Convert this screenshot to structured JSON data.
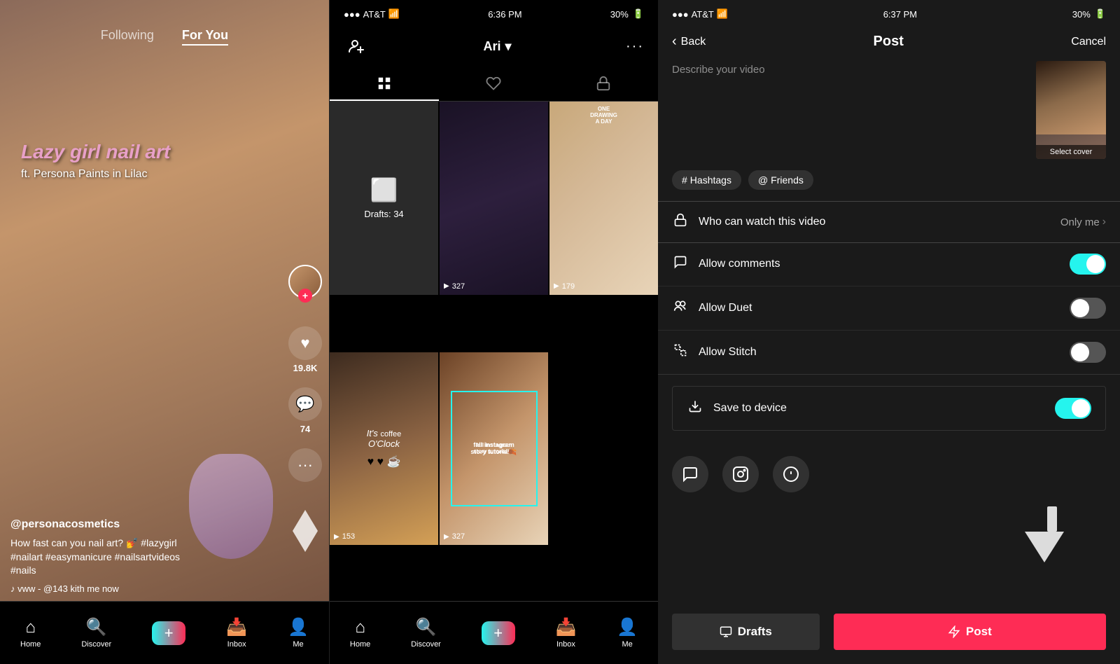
{
  "panel1": {
    "status": {
      "time": "6:36 PM",
      "carrier": "AT&T",
      "battery": "30%",
      "signal": "●●●"
    },
    "nav": {
      "following": "Following",
      "forYou": "For You"
    },
    "video": {
      "title": "Lazy girl nail art",
      "subtitle": "ft. Persona Paints in Lilac"
    },
    "actions": {
      "likes": "19.8K",
      "comments": "74",
      "shares": "···"
    },
    "info": {
      "username": "@personacosmetics",
      "description": "How fast can you nail art? 💅 #lazygirl\n#nailart #easymanicure #nailsartvideos\n#nails",
      "music": "♪  vww - @143   kith me now"
    },
    "bottomNav": {
      "home": "Home",
      "discover": "Discover",
      "inbox": "Inbox",
      "me": "Me"
    }
  },
  "panel2": {
    "status": {
      "time": "6:36 PM",
      "carrier": "AT&T",
      "battery": "30%"
    },
    "header": {
      "username": "Ari",
      "menu": "···"
    },
    "tabs": {
      "grid": "⊞",
      "liked": "♡",
      "private": "🔒"
    },
    "videos": [
      {
        "type": "draft",
        "label": "Drafts: 34",
        "icon": "⬜"
      },
      {
        "type": "dark",
        "plays": "327",
        "overlay": ""
      },
      {
        "type": "sweater",
        "plays": "179",
        "text": "ONE DRAWING A DAY"
      },
      {
        "type": "coffee",
        "plays": "153",
        "text": "It's coffee O'Clock"
      }
    ],
    "bottomNav": {
      "home": "Home",
      "discover": "Discover",
      "inbox": "Inbox",
      "me": "Me"
    }
  },
  "panel3": {
    "status": {
      "time": "6:37 PM",
      "carrier": "AT&T",
      "battery": "30%"
    },
    "header": {
      "back": "Back",
      "title": "Post",
      "cancel": "Cancel"
    },
    "describe": {
      "placeholder": "Describe your video",
      "coverLabel": "Select cover"
    },
    "tags": {
      "hashtags": "# Hashtags",
      "friends": "@ Friends"
    },
    "settings": {
      "whoCanWatch": {
        "label": "Who can watch this video",
        "value": "Only me"
      },
      "allowComments": {
        "label": "Allow comments",
        "enabled": true
      },
      "allowDuet": {
        "label": "Allow Duet",
        "enabled": false
      },
      "allowStitch": {
        "label": "Allow Stitch",
        "enabled": false
      },
      "saveToDevice": {
        "label": "Save to device",
        "enabled": true
      }
    },
    "actions": {
      "drafts": "Drafts",
      "post": "Post"
    }
  }
}
